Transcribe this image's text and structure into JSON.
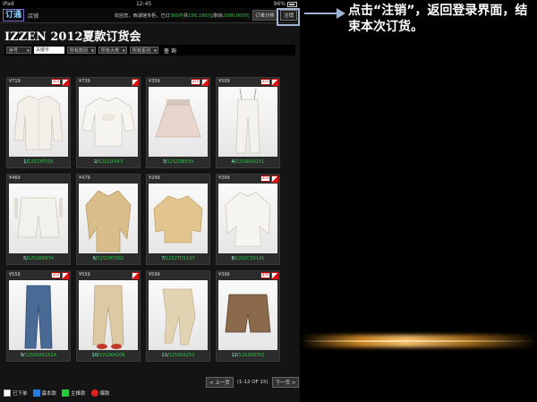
{
  "status": {
    "device": "iPad",
    "time": "12:45",
    "battery": "96%"
  },
  "header": {
    "logo": "订通",
    "store": "店铺",
    "welcome_prefix": "欢迎您，西湖馆专柜，已订",
    "welcome_count": "360件",
    "welcome_mid": "共",
    "welcome_amount": "156,180元",
    "welcome_mid2": "/剩余",
    "welcome_remain": "2000,000元",
    "order_btn": "订单分析",
    "logout_btn": "注销"
  },
  "title": "IZZEN 2012夏款订货会",
  "filters": {
    "sort": "序号",
    "keyword": "关键字",
    "category": "所有款别",
    "type": "所有大类",
    "series": "所有系列",
    "query": "查 询"
  },
  "products": [
    {
      "price": "¥719",
      "badge": "2/3",
      "code_prefix": "1/",
      "code": "12S2XF505"
    },
    {
      "price": "¥739",
      "badge": "",
      "code_prefix": "2/",
      "code": "12S2JX543"
    },
    {
      "price": "¥359",
      "badge": "2/3",
      "code_prefix": "3/",
      "code": "12S2QB539"
    },
    {
      "price": "¥509",
      "badge": "2/3",
      "code_prefix": "4/",
      "code": "12SSKA5151"
    },
    {
      "price": "¥469",
      "badge": "",
      "code_prefix": "5/",
      "code": "12S2KB974"
    },
    {
      "price": "¥479",
      "badge": "",
      "code_prefix": "6/",
      "code": "12S2MY582"
    },
    {
      "price": "¥299",
      "badge": "",
      "code_prefix": "7/",
      "code": "12S2TD5107"
    },
    {
      "price": "¥399",
      "badge": "2/3",
      "code_prefix": "8/",
      "code": "12S2CS5141"
    },
    {
      "price": "¥559",
      "badge": "2/3",
      "code_prefix": "9/",
      "code": "12S2KA5152A"
    },
    {
      "price": "¥559",
      "badge": "",
      "code_prefix": "10/",
      "code": "12S2KA208"
    },
    {
      "price": "¥599",
      "badge": "",
      "code_prefix": "11/",
      "code": "12S2KA252"
    },
    {
      "price": "¥399",
      "badge": "4/4",
      "code_prefix": "12/",
      "code": "12S2KB762"
    }
  ],
  "pager": {
    "prev": "< 上一页",
    "info": "(1-12 OF 15)",
    "next": "下一页 >"
  },
  "legend": [
    {
      "label": "已下单",
      "color": "#ffffff"
    },
    {
      "label": "基本款",
      "color": "#2a7be0"
    },
    {
      "label": "主推款",
      "color": "#27c93f"
    },
    {
      "label": "爆款",
      "color": "#e02020"
    }
  ],
  "callout": "点击“注销”，返回登录界面，结束本次订货。"
}
